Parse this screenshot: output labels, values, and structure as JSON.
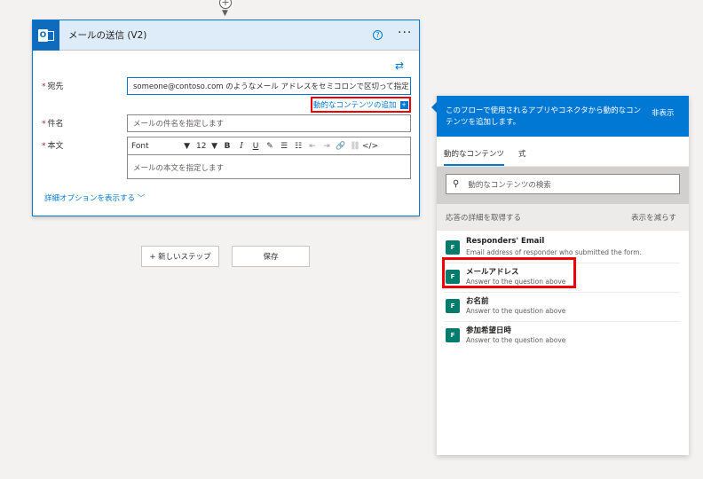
{
  "action": {
    "title": "メールの送信 (V2)",
    "help_glyph": "?",
    "more_glyph": "···",
    "swap_glyph": "⇄",
    "to": {
      "label": "宛先",
      "value": "someone@contoso.com のようなメール アドレスをセミコロンで区切って指定"
    },
    "add_dynamic_content": "動的なコンテンツの追加",
    "subject": {
      "label": "件名",
      "placeholder": "メールの件名を指定します"
    },
    "body": {
      "label": "本文",
      "placeholder": "メールの本文を指定します"
    },
    "toolbar": {
      "font": "Font",
      "size": "12",
      "bold": "B",
      "italic": "I",
      "underline": "U",
      "pen": "✎",
      "bullets": "☰",
      "numbers": "☷",
      "outdent": "⇤",
      "indent": "⇥",
      "link": "🔗",
      "unlink": "⛓",
      "code": "</>"
    },
    "show_advanced": "詳細オプションを表示する"
  },
  "buttons": {
    "new_step": "+ 新しいステップ",
    "save": "保存"
  },
  "panel": {
    "description": "このフローで使用されるアプリやコネクタから動的なコンテンツを追加します。",
    "hide": "非表示",
    "tabs": [
      "動的なコンテンツ",
      "式"
    ],
    "search_placeholder": "動的なコンテンツの検索",
    "section": {
      "title": "応答の詳細を取得する",
      "toggle": "表示を減らす"
    },
    "items": [
      {
        "name": "Responders' Email",
        "sub": "Email address of responder who submitted the form."
      },
      {
        "name": "メールアドレス",
        "sub": "Answer to the question above"
      },
      {
        "name": "お名前",
        "sub": "Answer to the question above"
      },
      {
        "name": "参加希望日時",
        "sub": "Answer to the question above"
      }
    ]
  },
  "colors": {
    "accent": "#0078d4",
    "highlight": "#ee0000",
    "forms_icon": "#037c6e"
  }
}
